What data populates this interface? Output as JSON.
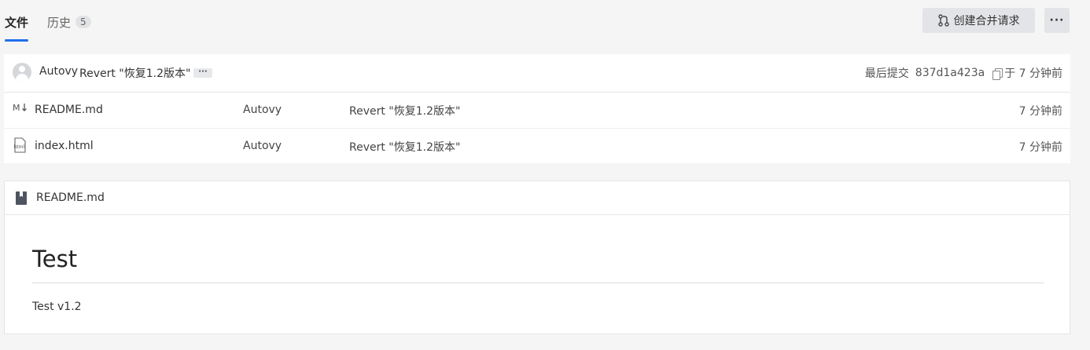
{
  "tabs": [
    {
      "label": "文件",
      "active": true
    },
    {
      "label": "历史",
      "count": "5"
    }
  ],
  "actions": {
    "merge_request_label": "创建合并请求",
    "more_label": "···"
  },
  "latest_commit": {
    "author": "Autovy",
    "message": "Revert \"恢复1.2版本\"",
    "ellipsis": "···",
    "last_commit_label": "最后提交",
    "hash": "837d1a423a",
    "time": "于 7 分钟前"
  },
  "files": [
    {
      "icon": "markdown-icon",
      "name": "README.md",
      "author": "Autovy",
      "message": "Revert \"恢复1.2版本\"",
      "time": "7 分钟前"
    },
    {
      "icon": "html-file-icon",
      "name": "index.html",
      "author": "Autovy",
      "message": "Revert \"恢复1.2版本\"",
      "time": "7 分钟前"
    }
  ],
  "readme": {
    "title": "README.md",
    "heading": "Test",
    "paragraph": "Test v1.2"
  },
  "colors": {
    "accent": "#1f6feb",
    "background": "#f5f5f5"
  }
}
